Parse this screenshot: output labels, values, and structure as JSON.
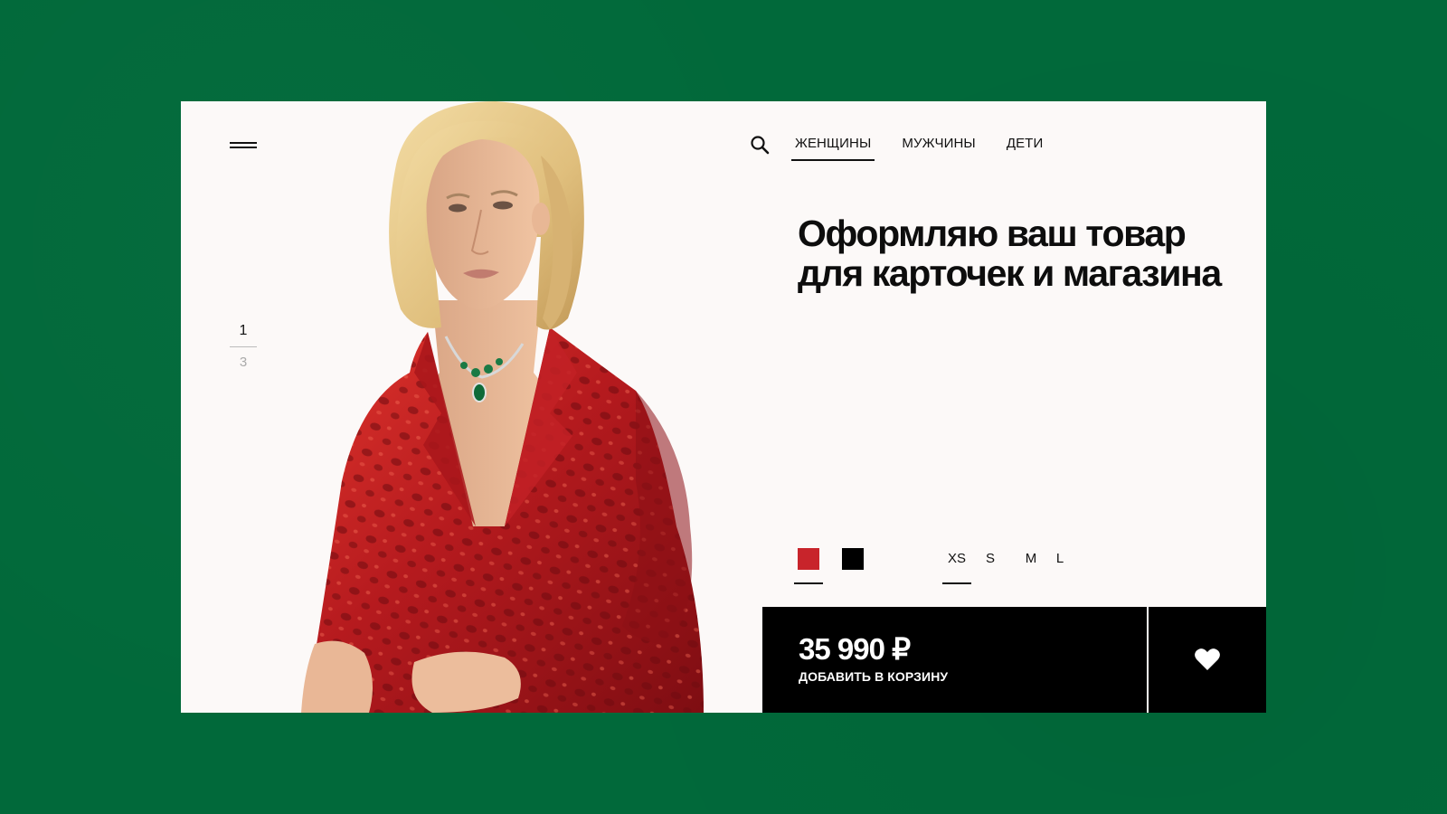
{
  "header": {
    "menu_icon": "hamburger-menu-icon",
    "search_icon": "search-icon",
    "tabs": [
      {
        "label": "ЖЕНЩИНЫ",
        "active": true
      },
      {
        "label": "МУЖЧИНЫ",
        "active": false
      },
      {
        "label": "ДЕТИ",
        "active": false
      }
    ]
  },
  "pager": {
    "current": "1",
    "total": "3"
  },
  "product": {
    "headline": "Оформляю ваш товар для карточек и магазина",
    "colors": [
      {
        "name": "red",
        "hex": "#c8242b",
        "selected": true
      },
      {
        "name": "black",
        "hex": "#000000",
        "selected": false
      }
    ],
    "sizes": [
      {
        "label": "XS",
        "selected": true
      },
      {
        "label": "S",
        "selected": false
      },
      {
        "label": "M",
        "selected": false
      },
      {
        "label": "L",
        "selected": false
      }
    ],
    "price": "35 990 ₽",
    "add_to_cart": "ДОБАВИТЬ В КОРЗИНУ",
    "favorite_icon": "heart-icon"
  },
  "theme": {
    "background": "#01693a",
    "card": "#fcf9f8",
    "accent": "#000000"
  }
}
